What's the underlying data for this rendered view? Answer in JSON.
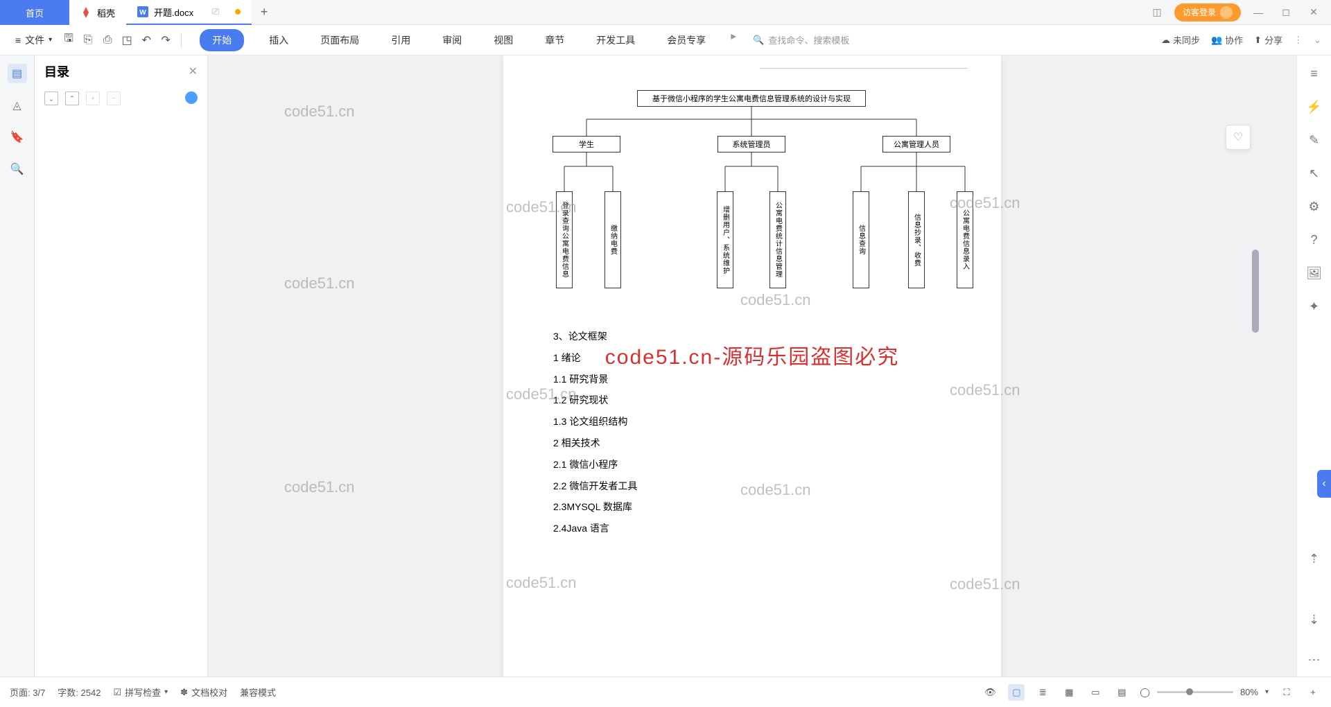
{
  "tabs": {
    "home": "首页",
    "dk": "稻壳",
    "doc": "开题.docx"
  },
  "login": "访客登录",
  "file_menu": "文件",
  "menus": [
    "开始",
    "插入",
    "页面布局",
    "引用",
    "审阅",
    "视图",
    "章节",
    "开发工具",
    "会员专享"
  ],
  "search_placeholder": "查找命令、搜索模板",
  "toolbar_right": {
    "sync": "未同步",
    "collab": "协作",
    "share": "分享"
  },
  "sidebar": {
    "title": "目录"
  },
  "diagram": {
    "root": "基于微信小程序的学生公寓电费信息管理系统的设计与实现",
    "level2": [
      "学生",
      "系统管理员",
      "公寓管理人员"
    ],
    "level3": [
      "登录查询公寓电费信息",
      "缴纳电费",
      "增删用户、系统维护",
      "公寓电费统计信息管理",
      "信息查询",
      "信息抄录、收费",
      "公寓电费信息录入"
    ]
  },
  "doc_lines": [
    "3、论文框架",
    "1 绪论",
    "1.1 研究背景",
    "1.2 研究现状",
    "1.3 论文组织结构",
    "2 相关技术",
    "2.1 微信小程序",
    "2.2 微信开发者工具",
    "2.3MYSQL 数据库",
    "2.4Java 语言"
  ],
  "watermark": "code51.cn",
  "watermark_red": "code51.cn-源码乐园盗图必究",
  "status": {
    "page": "页面: 3/7",
    "words": "字数: 2542",
    "spell": "拼写检查",
    "proof": "文档校对",
    "compat": "兼容模式",
    "zoom": "80%"
  }
}
